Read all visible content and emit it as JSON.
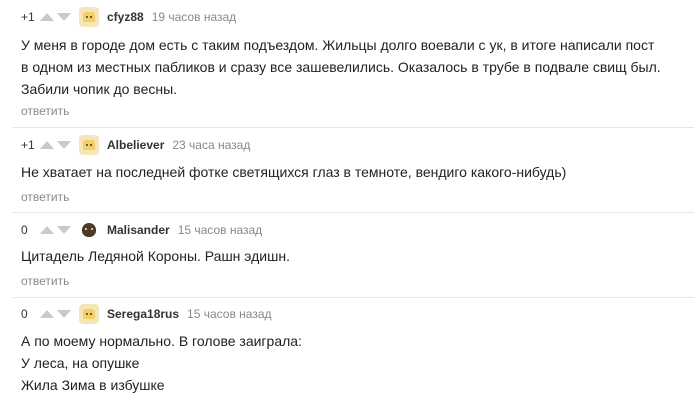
{
  "comments": [
    {
      "rating": "+1",
      "author": "cfyz88",
      "time": "19 часов назад",
      "lines": [
        "У меня в городе дом есть с таким подъездом. Жильцы долго воевали с ук, в итоге написали пост",
        "в одном из местных пабликов и сразу все зашевелились. Оказалось в трубе в подвале свищ был.",
        "Забили чопик до весны."
      ],
      "reply": "ответить"
    },
    {
      "rating": "+1",
      "author": "Albeliever",
      "time": "23 часа назад",
      "lines": [
        "Не хватает на последней фотке светящихся глаз в темноте, вендиго какого-нибудь)"
      ],
      "reply": "ответить"
    },
    {
      "rating": "0",
      "author": "Malisander",
      "time": "15 часов назад",
      "lines": [
        "Цитадель Ледяной Короны. Рашн эдишн."
      ],
      "reply": "ответить"
    },
    {
      "rating": "0",
      "author": "Serega18rus",
      "time": "15 часов назад",
      "lines": [
        "А по моему нормально. В голове заиграла:",
        "У леса, на опушке",
        "Жила Зима в избушке"
      ],
      "reply": ""
    }
  ]
}
